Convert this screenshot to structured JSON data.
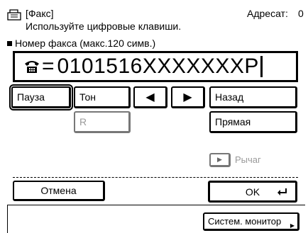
{
  "header": {
    "title": "[Факс]",
    "hint": "Используйте цифровые клавиши.",
    "destination_label": "Адресат:",
    "destination_count": "0"
  },
  "fax_field": {
    "label": "Номер факса (макс.120 симв.)",
    "prefix": "=",
    "value": "0101516XXXXXXXP"
  },
  "keys": {
    "pause": "Пауза",
    "tone": "Тон",
    "left_arrow": "◀",
    "right_arrow": "▶",
    "back": "Назад",
    "r": "R",
    "direct": "Прямая",
    "hook": "Рычаг"
  },
  "actions": {
    "cancel": "Отмена",
    "ok": "OK"
  },
  "footer": {
    "system_monitor": "Систем. монитор"
  },
  "icons": [
    "fax-machine-icon",
    "phone-icon",
    "enter-icon",
    "arrow-right-icon"
  ]
}
